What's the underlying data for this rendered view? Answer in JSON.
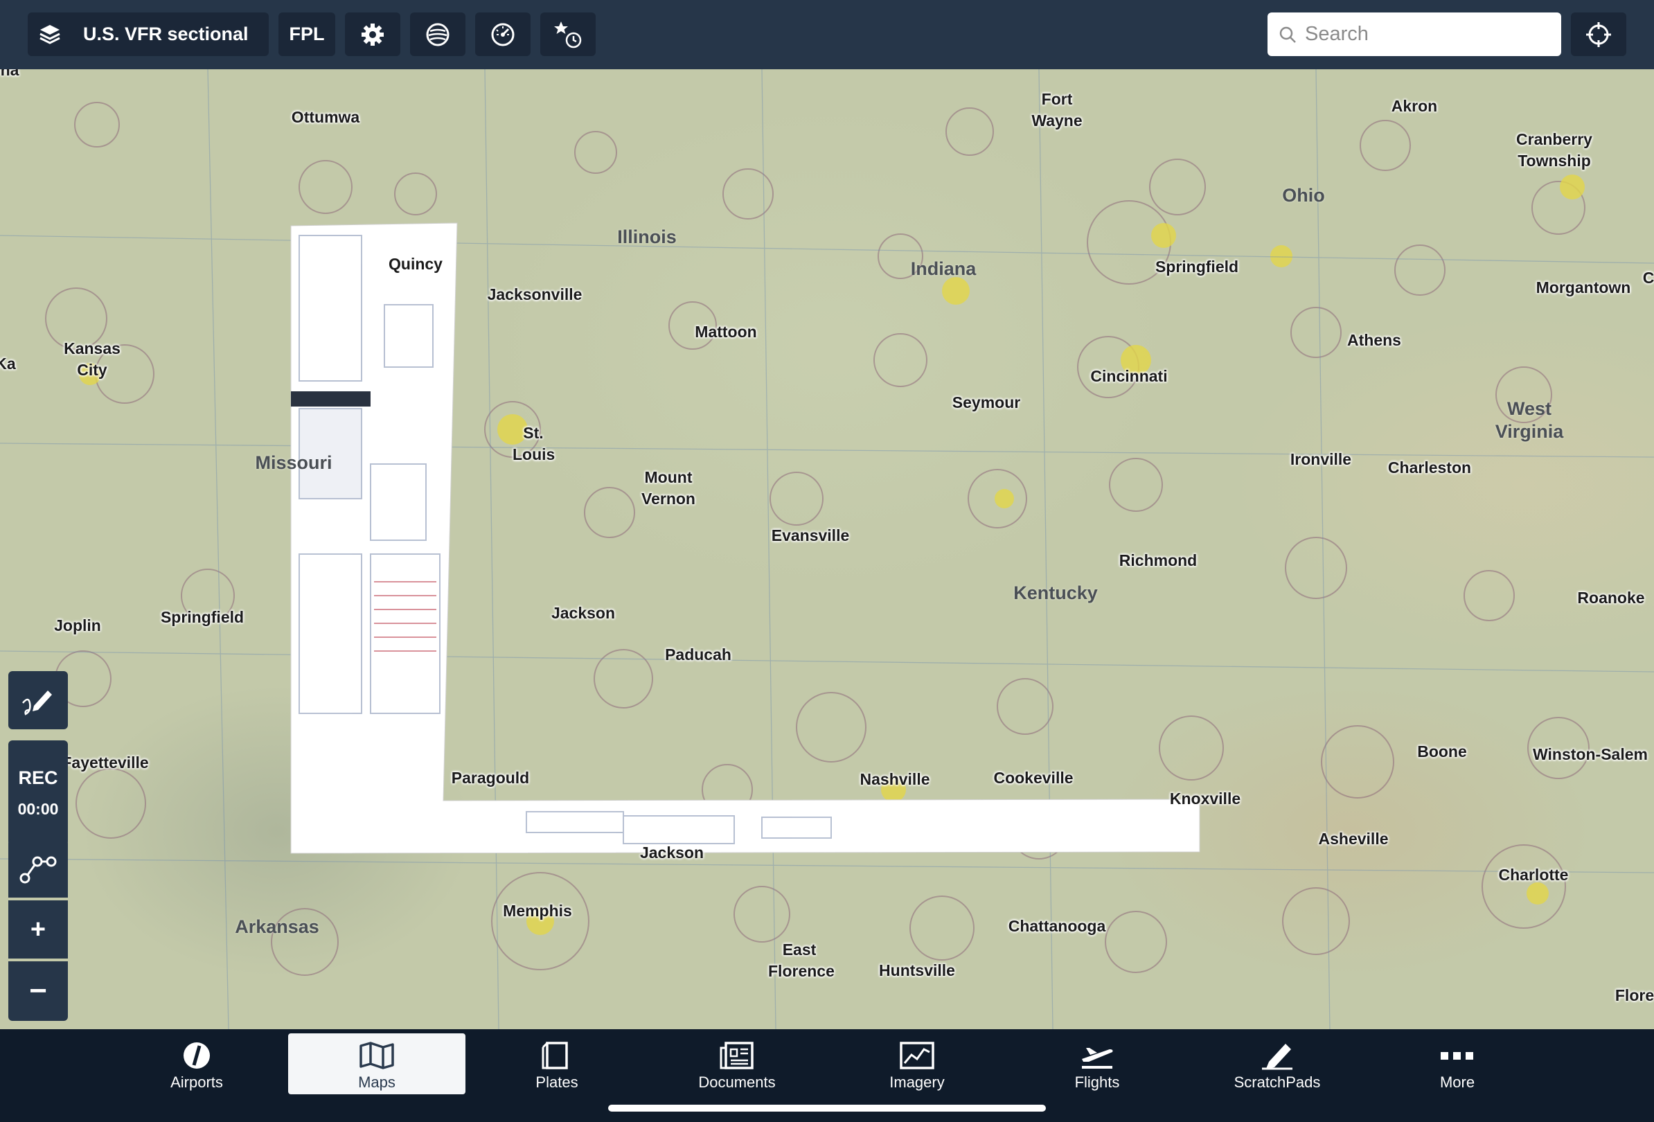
{
  "toolbar": {
    "layer_label": "U.S. VFR sectional",
    "fpl_label": "FPL",
    "search_placeholder": "Search"
  },
  "map": {
    "states": [
      {
        "name": "Illinois"
      },
      {
        "name": "Indiana"
      },
      {
        "name": "Ohio"
      },
      {
        "name": "Missouri"
      },
      {
        "name": "Kentucky"
      },
      {
        "name": "West Virginia"
      },
      {
        "name": "Arkansas"
      }
    ],
    "cities": [
      "Ottumwa",
      "Fort Wayne",
      "Akron",
      "Cranberry Township",
      "Quincy",
      "Jacksonville",
      "Springfield",
      "Morgantown",
      "Kansas City",
      "Mattoon",
      "Athens",
      "Cincinnati",
      "Seymour",
      "St. Louis",
      "Mount Vernon",
      "Ironville",
      "Charleston",
      "Evansville",
      "Richmond",
      "Jackson",
      "Roanoke",
      "Joplin",
      "Springfield",
      "Paducah",
      "Boone",
      "Winston-Salem",
      "Fayetteville",
      "Paragould",
      "Nashville",
      "Cookeville",
      "Knoxville",
      "Asheville",
      "Jackson",
      "Charlotte",
      "Memphis",
      "Chattanooga",
      "East Florence",
      "Huntsville",
      "Flore",
      "Ka",
      "na",
      "C"
    ]
  },
  "left_tools": {
    "rec_label": "REC",
    "rec_time": "00:00",
    "zoom_in": "+",
    "zoom_out": "−"
  },
  "tabs": [
    {
      "label": "Airports",
      "icon": "airports-icon"
    },
    {
      "label": "Maps",
      "icon": "maps-icon",
      "active": true
    },
    {
      "label": "Plates",
      "icon": "plates-icon"
    },
    {
      "label": "Documents",
      "icon": "documents-icon"
    },
    {
      "label": "Imagery",
      "icon": "imagery-icon"
    },
    {
      "label": "Flights",
      "icon": "flights-icon"
    },
    {
      "label": "ScratchPads",
      "icon": "scratchpads-icon"
    },
    {
      "label": "More",
      "icon": "more-icon"
    }
  ]
}
